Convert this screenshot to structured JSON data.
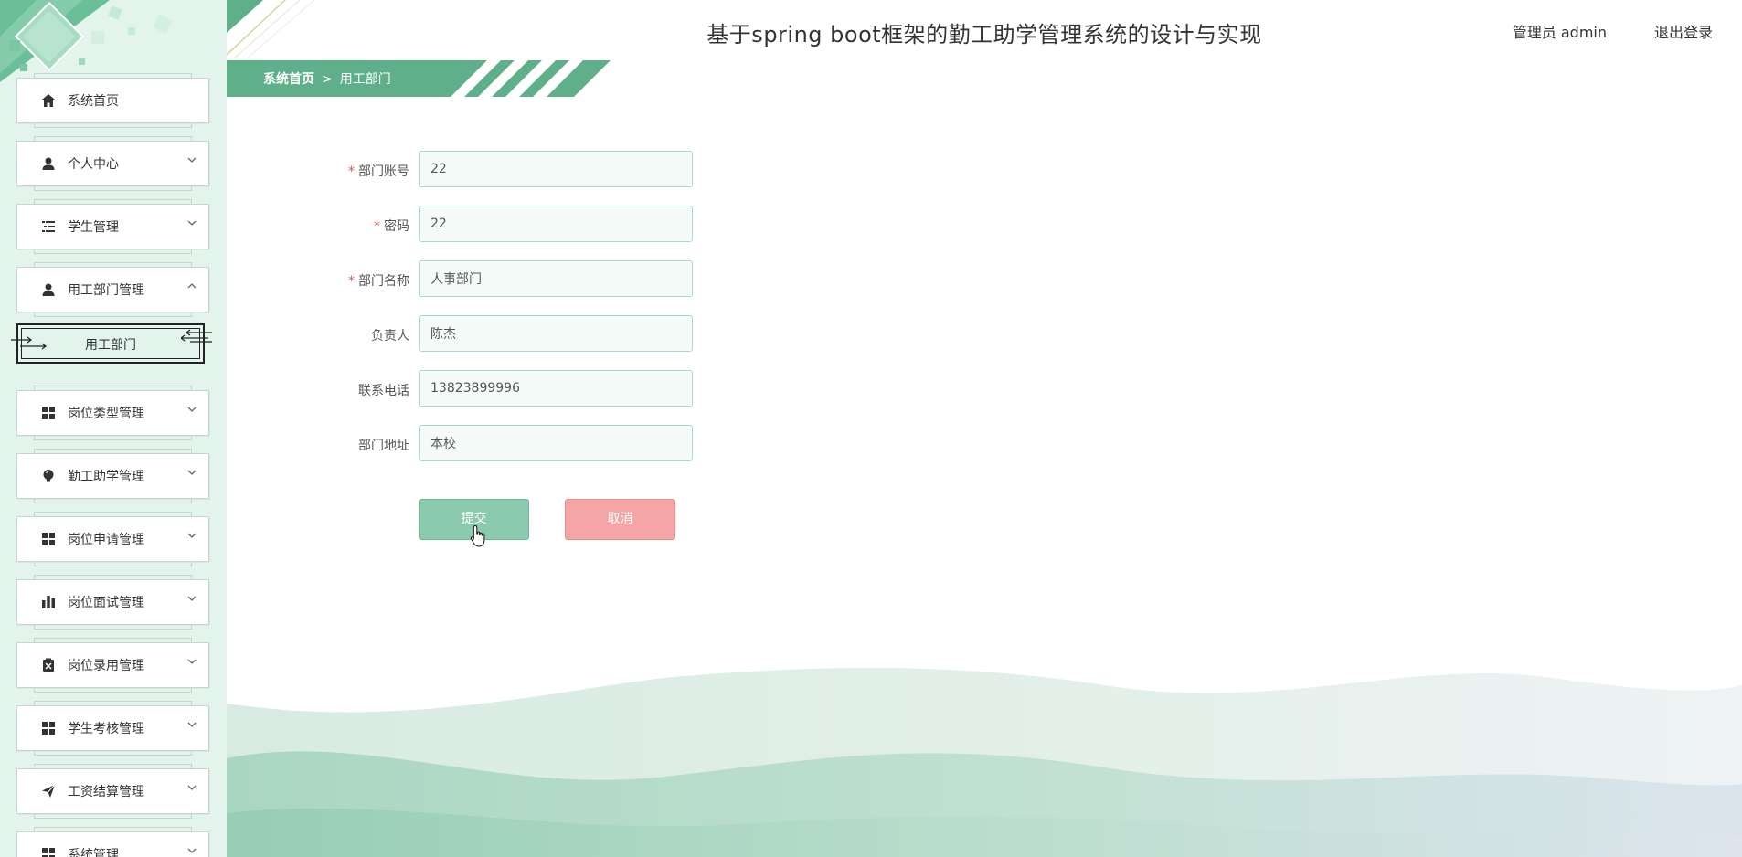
{
  "header": {
    "title": "基于spring boot框架的勤工助学管理系统的设计与实现",
    "user_text": "管理员 admin",
    "logout_label": "退出登录"
  },
  "breadcrumb": {
    "home": "系统首页",
    "separator": ">",
    "current": "用工部门"
  },
  "sidebar": {
    "items": [
      {
        "label": "系统首页",
        "icon": "home-icon"
      },
      {
        "label": "个人中心",
        "icon": "user-icon"
      },
      {
        "label": "学生管理",
        "icon": "list-icon"
      },
      {
        "label": "用工部门管理",
        "icon": "user-icon"
      },
      {
        "label": "岗位类型管理",
        "icon": "grid-icon"
      },
      {
        "label": "勤工助学管理",
        "icon": "bulb-icon"
      },
      {
        "label": "岗位申请管理",
        "icon": "grid-icon"
      },
      {
        "label": "岗位面试管理",
        "icon": "bar-chart-icon"
      },
      {
        "label": "岗位录用管理",
        "icon": "clipboard-icon"
      },
      {
        "label": "学生考核管理",
        "icon": "grid-icon"
      },
      {
        "label": "工资结算管理",
        "icon": "send-icon"
      },
      {
        "label": "系统管理",
        "icon": "grid-icon"
      }
    ],
    "submenu": {
      "label": "用工部门"
    }
  },
  "form": {
    "fields": [
      {
        "label": "部门账号",
        "required": true,
        "value": "22"
      },
      {
        "label": "密码",
        "required": true,
        "value": "22"
      },
      {
        "label": "部门名称",
        "required": true,
        "value": "人事部门"
      },
      {
        "label": "负责人",
        "required": false,
        "value": "陈杰"
      },
      {
        "label": "联系电话",
        "required": false,
        "value": "13823899996"
      },
      {
        "label": "部门地址",
        "required": false,
        "value": "本校"
      }
    ],
    "required_mark": "*",
    "submit_label": "提交",
    "cancel_label": "取消"
  },
  "colors": {
    "accent": "#5fb08a",
    "sidebar_bg": "#e3f4ec",
    "input_border": "#a6dcc2",
    "submit_bg": "#8ccaae",
    "cancel_bg": "#f5a5a5"
  }
}
